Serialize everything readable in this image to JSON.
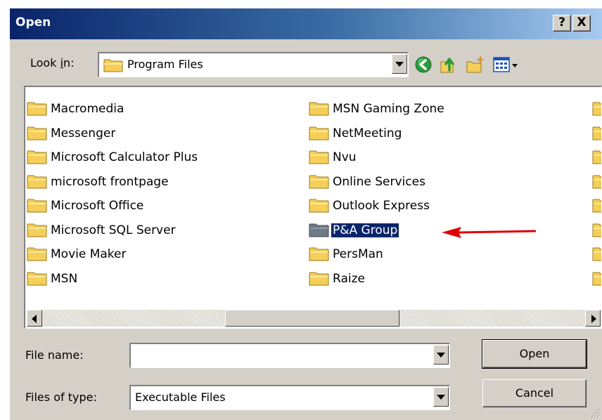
{
  "window": {
    "title": "Open",
    "help_label": "?",
    "close_label": "X"
  },
  "lookin": {
    "label_prefix": "Look ",
    "label_accel": "i",
    "label_suffix": "n:",
    "value": "Program Files"
  },
  "toolbar": {
    "icons": [
      "back-icon",
      "up-one-level-icon",
      "new-folder-icon",
      "views-menu-icon"
    ]
  },
  "filelist": {
    "column1": [
      "Macromedia",
      "Messenger",
      "Microsoft Calculator Plus",
      "microsoft frontpage",
      "Microsoft Office",
      "Microsoft SQL Server",
      "Movie Maker",
      "MSN"
    ],
    "column2": [
      "MSN Gaming Zone",
      "NetMeeting",
      "Nvu",
      "Online Services",
      "Outlook Express",
      "P&A Group",
      "PersMan",
      "Raize"
    ],
    "selected": "P&A Group"
  },
  "filename": {
    "label": "File name:",
    "value": ""
  },
  "filetype": {
    "label": "Files of type:",
    "value": "Executable Files"
  },
  "buttons": {
    "open": "Open",
    "cancel": "Cancel"
  },
  "colors": {
    "title_bar": "#0a246a",
    "dialog_face": "#d4d0c8",
    "selection": "#0a246a",
    "folder": "#f5cf5a",
    "annotation_arrow": "#e00000"
  }
}
